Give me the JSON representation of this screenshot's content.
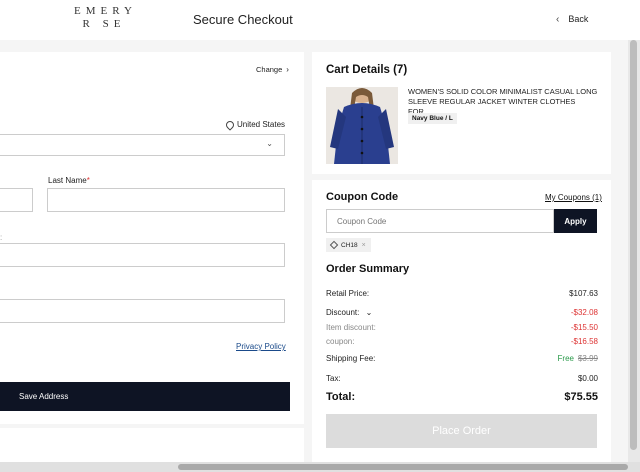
{
  "header": {
    "logo_line1": "EMERY",
    "logo_line2": "R  SE",
    "title": "Secure Checkout",
    "back_label": "Back"
  },
  "address": {
    "change_label": "Change",
    "country": "United States",
    "last_name_label": "Last Name",
    "required_mark": "*",
    "privacy_label": "Privacy Policy",
    "save_label": "Save Address"
  },
  "cart": {
    "title": "Cart Details (7)",
    "product_name": "WOMEN'S SOLID COLOR MINIMALIST CASUAL LONG SLEEVE REGULAR JACKET WINTER CLOTHES FOR...",
    "variant": "Navy Blue / L"
  },
  "coupon": {
    "title": "Coupon Code",
    "my_coupons": "My Coupons (1)",
    "placeholder": "Coupon Code",
    "apply_label": "Apply",
    "applied_code": "CH18",
    "remove_glyph": "×"
  },
  "summary": {
    "title": "Order Summary",
    "retail_label": "Retail Price:",
    "retail_value": "$107.63",
    "discount_label": "Discount:",
    "discount_value": "-$32.08",
    "item_discount_label": "Item discount:",
    "item_discount_value": "-$15.50",
    "coupon_label": "coupon:",
    "coupon_value": "-$16.58",
    "shipping_label": "Shipping Fee:",
    "shipping_free": "Free",
    "shipping_original": "$3.99",
    "tax_label": "Tax:",
    "tax_value": "$0.00",
    "total_label": "Total:",
    "total_value": "$75.55",
    "place_order_label": "Place Order"
  },
  "colors": {
    "accent_dark": "#0e1424",
    "discount_red": "#dd3333",
    "free_green": "#2a9a4a",
    "product_blue": "#2a3f8f"
  }
}
